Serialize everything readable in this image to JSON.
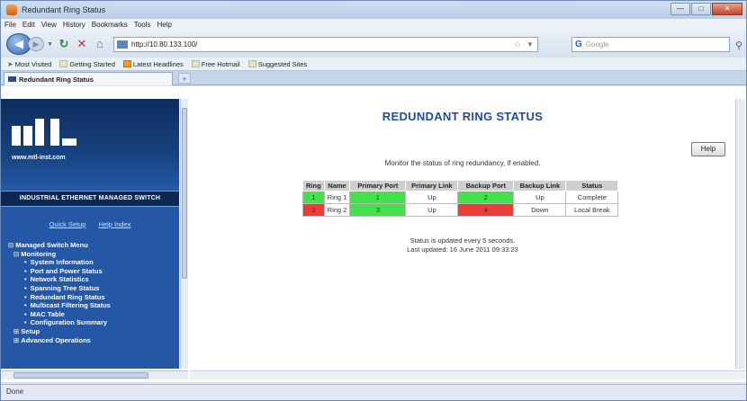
{
  "window": {
    "title": "Redundant Ring Status"
  },
  "menu": [
    "File",
    "Edit",
    "View",
    "History",
    "Bookmarks",
    "Tools",
    "Help"
  ],
  "nav": {
    "url": "http://10.80.133.100/",
    "search_placeholder": "Google"
  },
  "bookmarks": [
    "Most Visited",
    "Getting Started",
    "Latest Headlines",
    "Free Hotmail",
    "Suggested Sites"
  ],
  "tab": {
    "label": "Redundant Ring Status"
  },
  "sidebar": {
    "logo_url": "www.mtl-inst.com",
    "banner": "INDUSTRIAL ETHERNET MANAGED SWITCH",
    "links": [
      "Quick Setup",
      "Help Index"
    ],
    "tree": [
      {
        "label": "Managed Switch Menu",
        "level": 0,
        "mark": "minus"
      },
      {
        "label": "Monitoring",
        "level": 1,
        "mark": "minus"
      },
      {
        "label": "System Information",
        "level": 2
      },
      {
        "label": "Port and Power Status",
        "level": 2
      },
      {
        "label": "Network Statistics",
        "level": 2
      },
      {
        "label": "Spanning Tree Status",
        "level": 2
      },
      {
        "label": "Redundant Ring Status",
        "level": 2
      },
      {
        "label": "Multicast Filtering Status",
        "level": 2
      },
      {
        "label": "MAC Table",
        "level": 2
      },
      {
        "label": "Configuration Summary",
        "level": 2
      },
      {
        "label": "Setup",
        "level": 1,
        "mark": "plus"
      },
      {
        "label": "Advanced Operations",
        "level": 1,
        "mark": "plus"
      }
    ]
  },
  "main": {
    "title": "REDUNDANT RING STATUS",
    "help_label": "Help",
    "intro": "Monitor the status of ring redundancy, if enabled.",
    "table": {
      "headers": [
        "Ring",
        "Name",
        "Primary Port",
        "Primary Link",
        "Backup Port",
        "Backup Link",
        "Status"
      ],
      "rows": [
        {
          "ring": "1",
          "name": "Ring 1",
          "primary_port": "1",
          "primary_link": "Up",
          "backup_port": "2",
          "backup_link": "Up",
          "status": "Complete",
          "ring_color": "green",
          "primary_color": "green",
          "backup_color": "green"
        },
        {
          "ring": "2",
          "name": "Ring 2",
          "primary_port": "3",
          "primary_link": "Up",
          "backup_port": "4",
          "backup_link": "Down",
          "status": "Local Break",
          "ring_color": "red",
          "primary_color": "green",
          "backup_color": "red"
        }
      ]
    },
    "update_line1": "Status is updated every 5 seconds.",
    "update_line2": "Last updated: 16 June 2011 09:33:23"
  },
  "status_bar": "Done",
  "colors": {
    "accent": "#1f4e9c",
    "sidebar_bg": "#2457a6",
    "ok": "#44e24a",
    "fault": "#ec3c38"
  }
}
